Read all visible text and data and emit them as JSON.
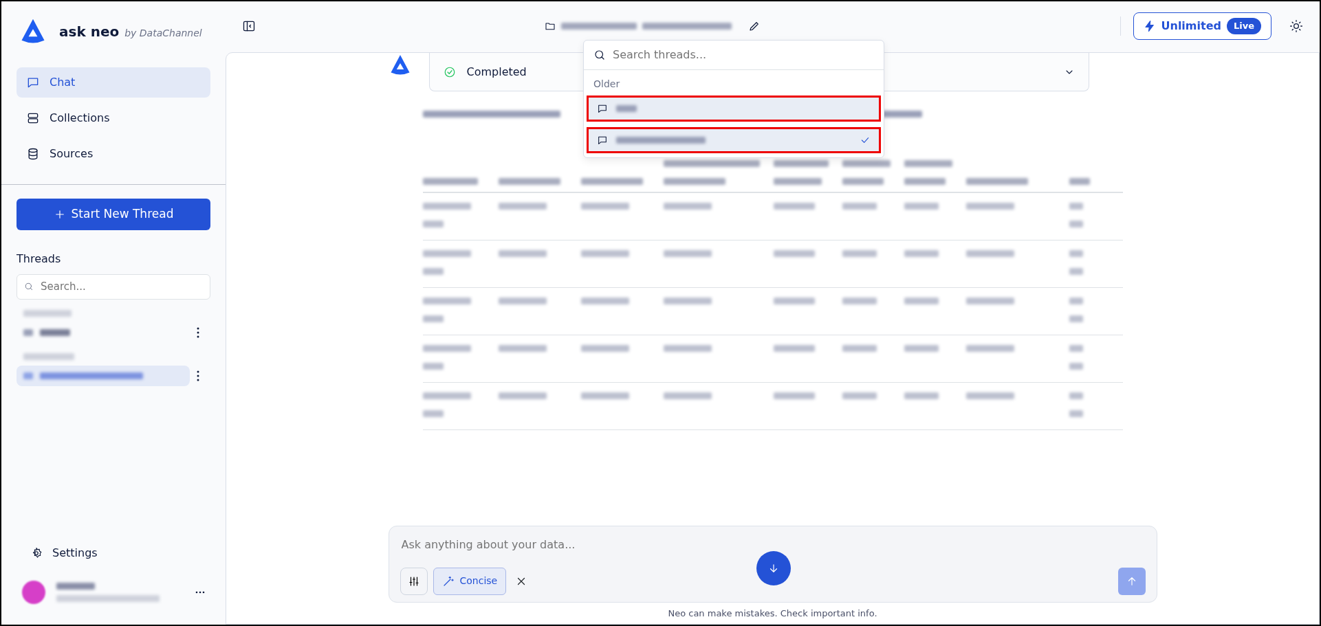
{
  "brand": {
    "name": "ask neo",
    "tagline": "by DataChannel"
  },
  "nav": [
    {
      "label": "Chat",
      "selected": true
    },
    {
      "label": "Collections",
      "selected": false
    },
    {
      "label": "Sources",
      "selected": false
    }
  ],
  "new_thread_button": "Start New Thread",
  "threads": {
    "title": "Threads",
    "search_placeholder": "Search...",
    "items": [
      {
        "selected": false
      },
      {
        "selected": true
      }
    ]
  },
  "settings": "Settings",
  "plan": {
    "label": "Unlimited",
    "badge": "Live"
  },
  "dropdown": {
    "search_placeholder": "Search threads...",
    "group": "Older",
    "items": [
      {
        "checked": false
      },
      {
        "checked": true
      }
    ]
  },
  "status": {
    "label": "Completed"
  },
  "composer": {
    "placeholder": "Ask anything about your data...",
    "mode": "Concise"
  },
  "disclaimer": "Neo can make mistakes. Check important info."
}
